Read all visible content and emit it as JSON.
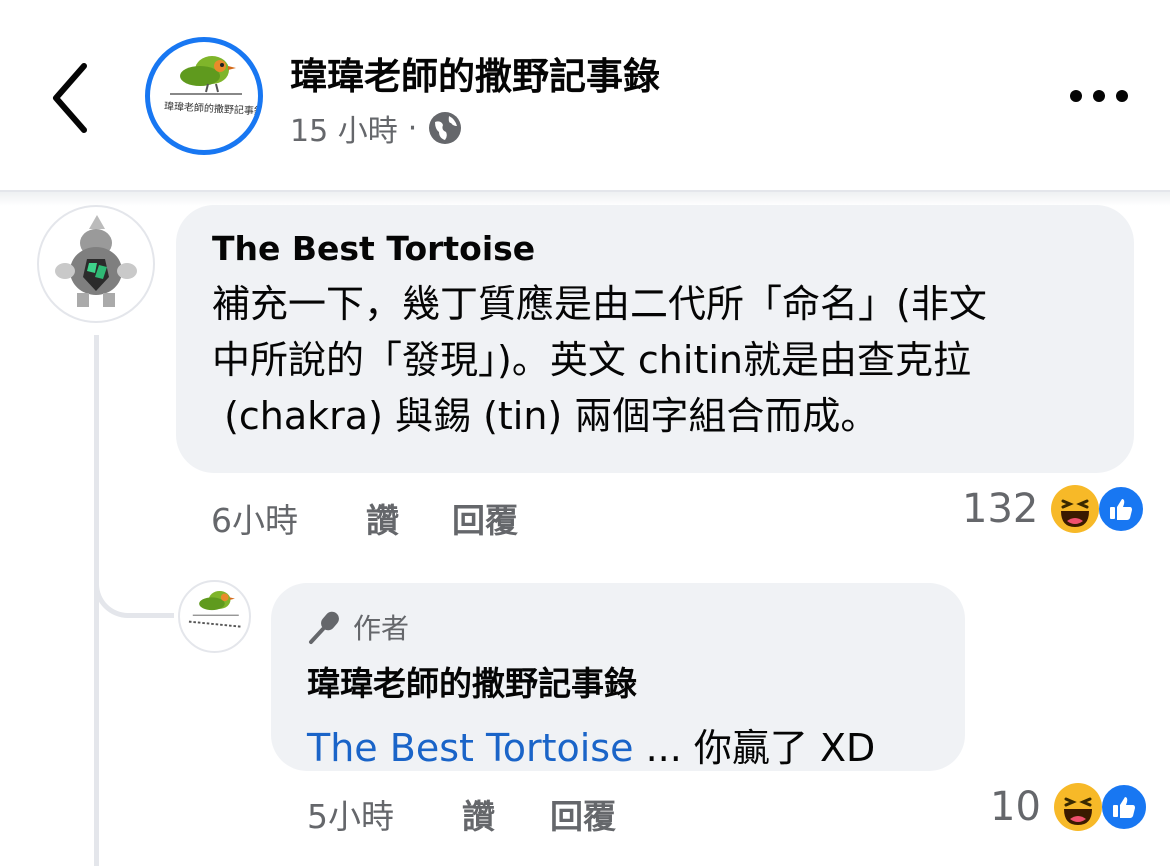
{
  "header": {
    "page_name": "瑋瑋老師的撒野記事錄",
    "time": "15 小時",
    "separator": "·",
    "privacy_icon": "globe-icon",
    "back_icon": "chevron-left-icon",
    "more_icon": "more-horizontal-icon",
    "logo_text": "瑋瑋老師的撒野記事錄"
  },
  "comment": {
    "author": "The Best Tortoise",
    "lines": [
      "補充一下，幾丁質應是由二代所「命名」(非文",
      "中所說的「發現」)。英文 chitin就是由查克拉",
      " (chakra) 與錫 (tin) 兩個字組合而成。"
    ],
    "time": "6小時",
    "like_label": "讚",
    "reply_label": "回覆",
    "reaction_count": "132",
    "reactions": [
      "haha-emoji",
      "like-emoji"
    ]
  },
  "reply": {
    "badge_label": "作者",
    "badge_icon": "microphone-icon",
    "author": "瑋瑋老師的撒野記事錄",
    "mention": "The Best Tortoise",
    "text": " ... 你贏了 XD",
    "time": "5小時",
    "like_label": "讚",
    "reply_label": "回覆",
    "reaction_count": "10",
    "reactions": [
      "haha-emoji",
      "like-emoji"
    ]
  },
  "colors": {
    "accent": "#1877f2",
    "mention": "#1a64c8",
    "secondary_text": "#65676b",
    "bubble": "#f0f2f5"
  }
}
